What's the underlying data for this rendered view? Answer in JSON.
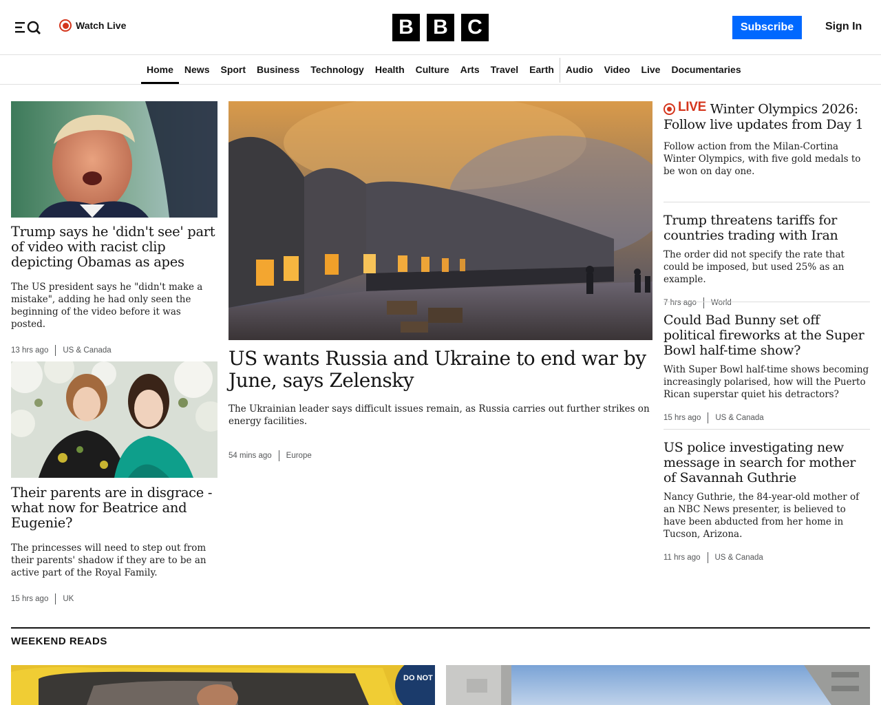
{
  "header": {
    "watch_live": "Watch Live",
    "logo_letters": [
      "B",
      "B",
      "C"
    ],
    "subscribe": "Subscribe",
    "sign_in": "Sign In"
  },
  "nav": {
    "items": [
      "Home",
      "News",
      "Sport",
      "Business",
      "Technology",
      "Health",
      "Culture",
      "Arts",
      "Travel",
      "Earth",
      "Audio",
      "Video",
      "Live",
      "Documentaries"
    ],
    "active": "Home"
  },
  "left": [
    {
      "headline": "Trump says he 'didn't see' part of video with racist clip depicting Obamas as apes",
      "summary": "The US president says he \"didn't make a mistake\", adding he had only seen the beginning of the video before it was posted.",
      "time": "13 hrs ago",
      "category": "US & Canada"
    },
    {
      "headline": "Their parents are in disgrace - what now for Beatrice and Eugenie?",
      "summary": "The princesses will need to step out from their parents' shadow if they are to be an active part of the Royal Family.",
      "time": "15 hrs ago",
      "category": "UK"
    }
  ],
  "center": {
    "headline": "US wants Russia and Ukraine to end war by June, says Zelensky",
    "summary": "The Ukrainian leader says difficult issues remain, as Russia carries out further strikes on energy facilities.",
    "time": "54 mins ago",
    "category": "Europe"
  },
  "right": [
    {
      "live_label": "LIVE",
      "headline": "Winter Olympics 2026: Follow live updates from Day 1",
      "summary": "Follow action from the Milan-Cortina Winter Olympics, with five gold medals to be won on day one."
    },
    {
      "headline": "Trump threatens tariffs for countries trading with Iran",
      "summary": "The order did not specify the rate that could be imposed, but used 25% as an example.",
      "time": "7 hrs ago",
      "category": "World"
    },
    {
      "headline": "Could Bad Bunny set off political fireworks at the Super Bowl half-time show?",
      "summary": "With Super Bowl half-time shows becoming increasingly polarised, how will the Puerto Rican superstar quiet his detractors?",
      "time": "15 hrs ago",
      "category": "US & Canada"
    },
    {
      "headline": "US police investigating new message in search for mother of Savannah Guthrie",
      "summary": "Nancy Guthrie, the 84-year-old mother of an NBC News presenter, is believed to have been abducted from her home in Tucson, Arizona.",
      "time": "11 hrs ago",
      "category": "US & Canada"
    }
  ],
  "weekend": {
    "title": "WEEKEND READS",
    "sign_text": "DO NOT SI DOOR"
  },
  "colors": {
    "accent": "#0068ff",
    "live": "#d4351c"
  }
}
